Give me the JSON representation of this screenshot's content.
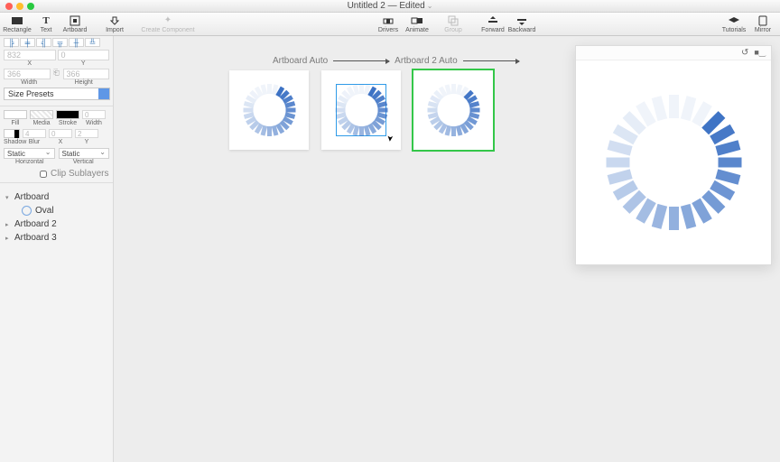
{
  "window": {
    "title": "Untitled 2 — Edited"
  },
  "toolbar": {
    "rectangle": "Rectangle",
    "text": "Text",
    "artboard": "Artboard",
    "import": "Import",
    "create_component": "Create Component",
    "drivers": "Drivers",
    "animate": "Animate",
    "group": "Group",
    "forward": "Forward",
    "backward": "Backward",
    "tutorials": "Tutorials",
    "mirror": "Mirror"
  },
  "inspector": {
    "x_label": "X",
    "y_label": "Y",
    "x_value": "832",
    "y_value": "0",
    "w_label": "Width",
    "h_label": "Height",
    "w_value": "366",
    "h_value": "366",
    "size_presets": "Size Presets",
    "fill": "Fill",
    "media": "Media",
    "stroke": "Stroke",
    "width": "Width",
    "shadow": "Shadow",
    "blur": "Blur",
    "blur_value": "4",
    "sx_value": "0",
    "sy_value": "2",
    "stroke_w": "0",
    "static": "Static",
    "horizontal": "Horizontal",
    "vertical": "Vertical",
    "clip_sublayers": "Clip Sublayers"
  },
  "layers": {
    "artboard": "Artboard",
    "oval": "Oval",
    "artboard2": "Artboard 2",
    "artboard3": "Artboard 3"
  },
  "canvas": {
    "label1": "Artboard Auto",
    "label2": "Artboard 2 Auto"
  },
  "colors": {
    "spinner_base": "#3d72c4"
  }
}
